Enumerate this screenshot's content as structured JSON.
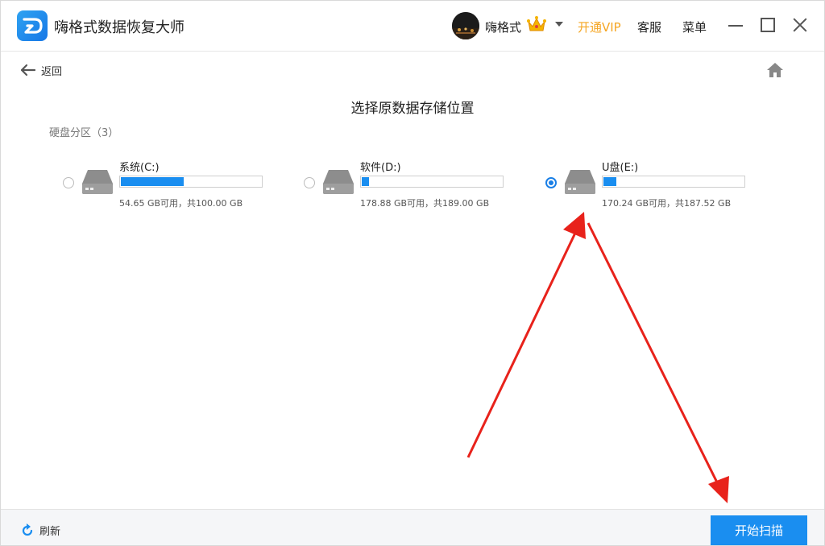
{
  "app": {
    "title": "嗨格式数据恢复大师",
    "user_name": "嗨格式",
    "vip_link": "开通VIP",
    "service_link": "客服",
    "menu_link": "菜单",
    "accent_color": "#1a8ef0",
    "vip_color": "#f5a623"
  },
  "nav": {
    "back_label": "返回"
  },
  "page": {
    "title": "选择原数据存储位置",
    "partition_header": "硬盘分区（3）"
  },
  "partitions": [
    {
      "name": "系统(C:)",
      "info": "54.65 GB可用，共100.00 GB",
      "used_fraction": 0.45,
      "selected": false
    },
    {
      "name": "软件(D:)",
      "info": "178.88 GB可用，共189.00 GB",
      "used_fraction": 0.05,
      "selected": false
    },
    {
      "name": "U盘(E:)",
      "info": "170.24 GB可用，共187.52 GB",
      "used_fraction": 0.09,
      "selected": true
    }
  ],
  "footer": {
    "refresh_label": "刷新",
    "start_scan_label": "开始扫描"
  }
}
